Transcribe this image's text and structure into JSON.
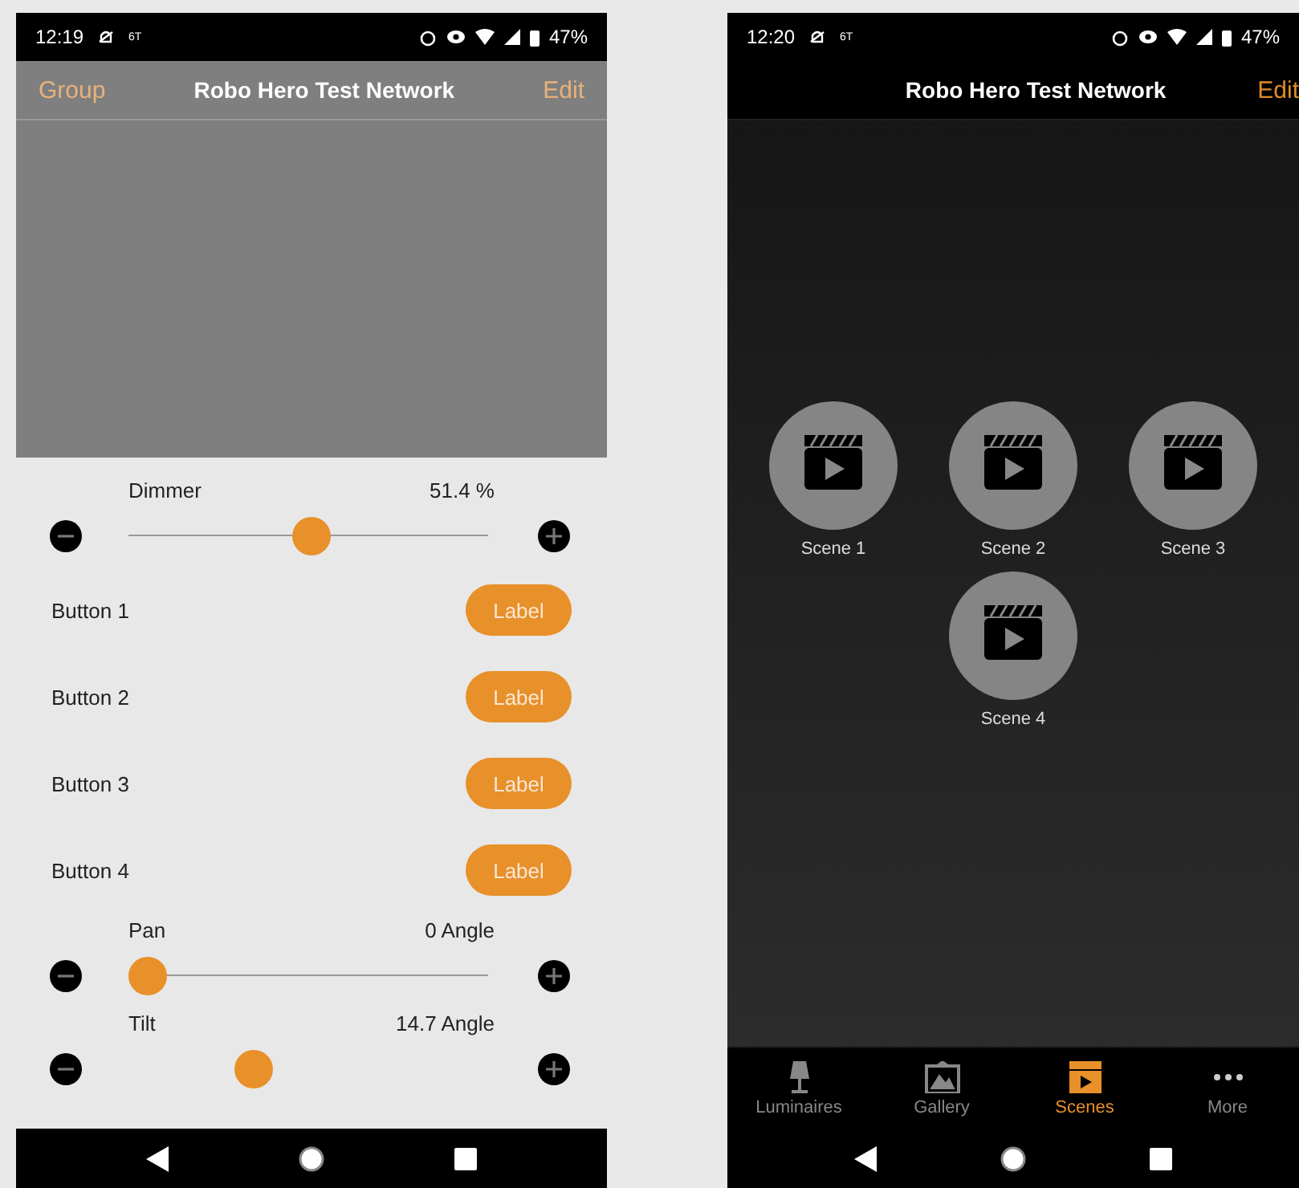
{
  "left_phone": {
    "status_bar": {
      "time": "12:19",
      "network": "6T",
      "battery": "47%"
    },
    "header": {
      "back": "Group",
      "title": "Robo Hero Test Network",
      "action": "Edit"
    },
    "controls": [
      {
        "kind": "slider",
        "label": "Dimmer",
        "reading": "51.4 %",
        "level": 0.51,
        "track_visible": true
      },
      {
        "kind": "button",
        "label": "Button 1",
        "button": "Label"
      },
      {
        "kind": "button",
        "label": "Button 2",
        "button": "Label"
      },
      {
        "kind": "button",
        "label": "Button 3",
        "button": "Label"
      },
      {
        "kind": "button",
        "label": "Button 4",
        "button": "Label"
      },
      {
        "kind": "slider",
        "label": "Pan",
        "reading": "0 Angle",
        "level": 0,
        "track_visible": true
      },
      {
        "kind": "slider",
        "label": "Tilt",
        "reading": "14.7 Angle",
        "level": 0.33,
        "track_visible": false
      }
    ]
  },
  "right_phone": {
    "status_bar": {
      "time": "12:20",
      "network": "6T",
      "battery": "47%"
    },
    "header": {
      "title": "Robo Hero Test Network",
      "action": "Edit"
    },
    "scenes": [
      {
        "name": "Scene 1"
      },
      {
        "name": "Scene 2"
      },
      {
        "name": "Scene 3"
      },
      {
        "name": "Scene 4"
      }
    ],
    "tabs": [
      {
        "label": "Luminaires",
        "selected": false
      },
      {
        "label": "Gallery",
        "selected": false
      },
      {
        "label": "Scenes",
        "selected": true
      },
      {
        "label": "More",
        "selected": false
      }
    ]
  }
}
